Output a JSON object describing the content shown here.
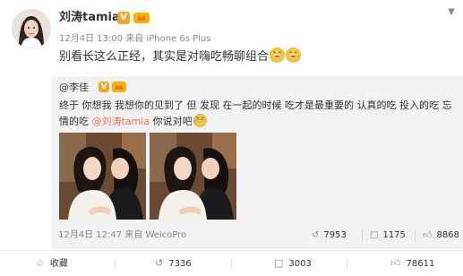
{
  "post": {
    "username": "刘涛tamia",
    "vip_badge": "V",
    "meta": "12月4日 13:00 来自 iPhone 6s Plus",
    "text": "别看长这么正经，其实是对嗨吃畅聊组合"
  },
  "repost": {
    "author": "@李佳",
    "vip_badge": "V",
    "text_before": "终于 你想我 我想你的见到了 但 发现 在一起的时候 吃才是最重要的 认真的吃 投入的吃 忘情的吃 ",
    "mention": "@刘涛tamia",
    "text_after": " 你说对吧",
    "meta": "12月4日 12:47 来自 WeicoPro",
    "repost_count": "7953",
    "comment_count": "1175",
    "like_count": "8868"
  },
  "footer": {
    "favorite_label": "收藏",
    "repost_count": "7336",
    "comment_count": "3003",
    "like_count": "78611"
  },
  "icons": {
    "menu": "chevron-down-icon",
    "repost": "repost-icon",
    "comment": "comment-icon",
    "like": "thumbs-up-icon",
    "favorite": "star-icon"
  },
  "colors": {
    "accent": "#eb7350",
    "badge": "#f5a623",
    "meta_text": "#8a8a8a",
    "repost_bg": "#f2f2f2"
  }
}
